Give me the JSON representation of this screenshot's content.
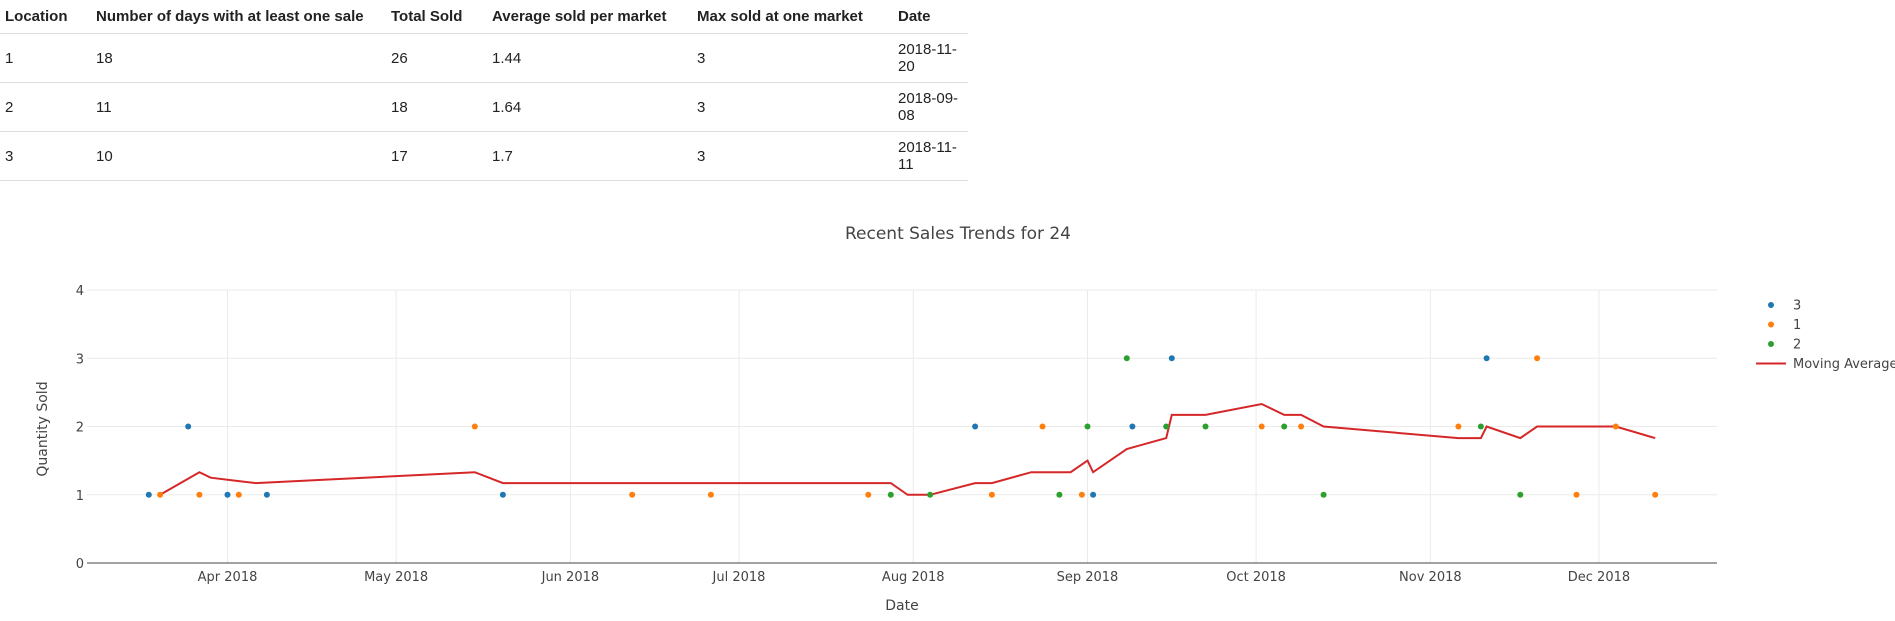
{
  "table": {
    "headers": [
      "Location",
      "Number of days with at least one sale",
      "Total Sold",
      "Average sold per market",
      "Max sold at one market",
      "Date"
    ],
    "rows": [
      [
        "1",
        "18",
        "26",
        "1.44",
        "3",
        "2018-11-20"
      ],
      [
        "2",
        "11",
        "18",
        "1.64",
        "3",
        "2018-09-08"
      ],
      [
        "3",
        "10",
        "17",
        "1.7",
        "3",
        "2018-11-11"
      ]
    ]
  },
  "chart_data": {
    "type": "scatter",
    "title": "Recent Sales Trends for 24",
    "xlabel": "Date",
    "ylabel": "Quantity Sold",
    "xlim": [
      "2018-03-07",
      "2018-12-22"
    ],
    "ylim": [
      0,
      4
    ],
    "x_ticks": [
      {
        "date": "2018-04-01",
        "label": "Apr 2018"
      },
      {
        "date": "2018-05-01",
        "label": "May 2018"
      },
      {
        "date": "2018-06-01",
        "label": "Jun 2018"
      },
      {
        "date": "2018-07-01",
        "label": "Jul 2018"
      },
      {
        "date": "2018-08-01",
        "label": "Aug 2018"
      },
      {
        "date": "2018-09-01",
        "label": "Sep 2018"
      },
      {
        "date": "2018-10-01",
        "label": "Oct 2018"
      },
      {
        "date": "2018-11-01",
        "label": "Nov 2018"
      },
      {
        "date": "2018-12-01",
        "label": "Dec 2018"
      }
    ],
    "y_ticks": [
      0,
      1,
      2,
      3,
      4
    ],
    "grid": true,
    "legend_position": "top-right",
    "series": [
      {
        "name": "3",
        "color": "#1f77b4",
        "kind": "markers",
        "x": [
          "2018-03-18",
          "2018-03-25",
          "2018-04-01",
          "2018-04-08",
          "2018-05-20",
          "2018-08-12",
          "2018-09-02",
          "2018-09-09",
          "2018-09-16",
          "2018-11-11"
        ],
        "y": [
          1,
          2,
          1,
          1,
          1,
          2,
          1,
          2,
          3,
          3
        ]
      },
      {
        "name": "1",
        "color": "#ff7f0e",
        "kind": "markers",
        "x": [
          "2018-03-20",
          "2018-03-27",
          "2018-04-03",
          "2018-05-15",
          "2018-06-12",
          "2018-06-26",
          "2018-07-24",
          "2018-08-15",
          "2018-08-24",
          "2018-08-31",
          "2018-10-02",
          "2018-10-09",
          "2018-11-06",
          "2018-11-20",
          "2018-11-27",
          "2018-12-04",
          "2018-12-11"
        ],
        "y": [
          1,
          1,
          1,
          2,
          1,
          1,
          1,
          1,
          2,
          1,
          2,
          2,
          2,
          3,
          1,
          2,
          1
        ]
      },
      {
        "name": "2",
        "color": "#2ca02c",
        "kind": "markers",
        "x": [
          "2018-07-28",
          "2018-08-04",
          "2018-08-27",
          "2018-09-01",
          "2018-09-08",
          "2018-09-15",
          "2018-09-22",
          "2018-10-06",
          "2018-10-13",
          "2018-11-10",
          "2018-11-17"
        ],
        "y": [
          1,
          1,
          1,
          2,
          3,
          2,
          2,
          2,
          1,
          2,
          1
        ]
      },
      {
        "name": "Moving Average",
        "color": "#d62728",
        "kind": "line",
        "x": [
          "2018-03-20",
          "2018-03-27",
          "2018-03-29",
          "2018-04-03",
          "2018-04-06",
          "2018-05-15",
          "2018-05-20",
          "2018-07-28",
          "2018-07-31",
          "2018-08-04",
          "2018-08-12",
          "2018-08-15",
          "2018-08-22",
          "2018-08-29",
          "2018-09-01",
          "2018-09-02",
          "2018-09-08",
          "2018-09-15",
          "2018-09-16",
          "2018-09-22",
          "2018-10-02",
          "2018-10-06",
          "2018-10-09",
          "2018-10-13",
          "2018-11-06",
          "2018-11-10",
          "2018-11-11",
          "2018-11-17",
          "2018-11-20",
          "2018-12-04",
          "2018-12-11"
        ],
        "y": [
          1.0,
          1.33,
          1.25,
          1.2,
          1.17,
          1.33,
          1.17,
          1.17,
          1.0,
          1.0,
          1.17,
          1.17,
          1.33,
          1.33,
          1.5,
          1.33,
          1.67,
          1.83,
          2.17,
          2.17,
          2.33,
          2.17,
          2.17,
          2.0,
          1.83,
          1.83,
          2.0,
          1.83,
          2.0,
          2.0,
          1.83
        ]
      }
    ]
  }
}
